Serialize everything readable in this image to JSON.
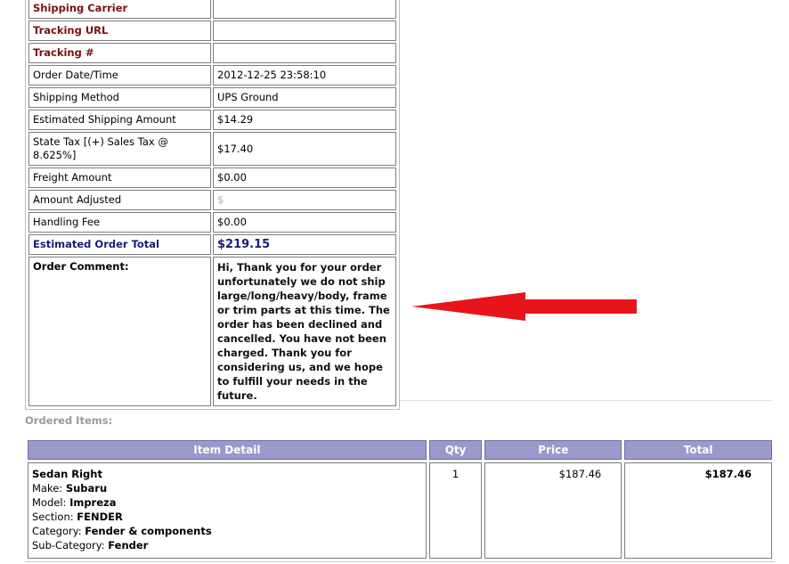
{
  "order_details": {
    "rows": [
      {
        "label": "Shipping Carrier",
        "value": ""
      },
      {
        "label": "Tracking URL",
        "value": ""
      },
      {
        "label": "Tracking #",
        "value": ""
      },
      {
        "label": "Order Date/Time",
        "value": "2012-12-25 23:58:10"
      },
      {
        "label": "Shipping Method",
        "value": "UPS Ground"
      },
      {
        "label": "Estimated Shipping Amount",
        "value": "$14.29"
      },
      {
        "label": "State Tax [(+) Sales Tax @ 8.625%]",
        "value": "$17.40"
      },
      {
        "label": "Freight Amount",
        "value": "$0.00"
      },
      {
        "label": "Amount Adjusted",
        "value": "$"
      },
      {
        "label": "Handling Fee",
        "value": "$0.00"
      },
      {
        "label": "Estimated Order Total",
        "value": "$219.15"
      }
    ],
    "comment_label": "Order Comment:",
    "comment_text": "Hi, Thank you for your order unfortunately we do not ship large/long/heavy/body, frame or trim parts at this time. The order has been declined and cancelled. You have not been charged. Thank you for considering us, and we hope to fulfill your needs in the future."
  },
  "ordered_items": {
    "title": "Ordered Items:",
    "headers": {
      "item_detail": "Item Detail",
      "qty": "Qty",
      "price": "Price",
      "total": "Total"
    },
    "items": [
      {
        "name": "Sedan Right",
        "make_label": "Make:",
        "make": "Subaru",
        "model_label": "Model:",
        "model": "Impreza",
        "section_label": "Section:",
        "section": "FENDER",
        "category_label": "Category:",
        "category": "Fender & components",
        "subcategory_label": "Sub-Category:",
        "subcategory": "Fender",
        "qty": "1",
        "price": "$187.46",
        "total": "$187.46"
      }
    ]
  },
  "annotation": {
    "arrow_color": "#e8141c",
    "arrow_direction": "left"
  }
}
